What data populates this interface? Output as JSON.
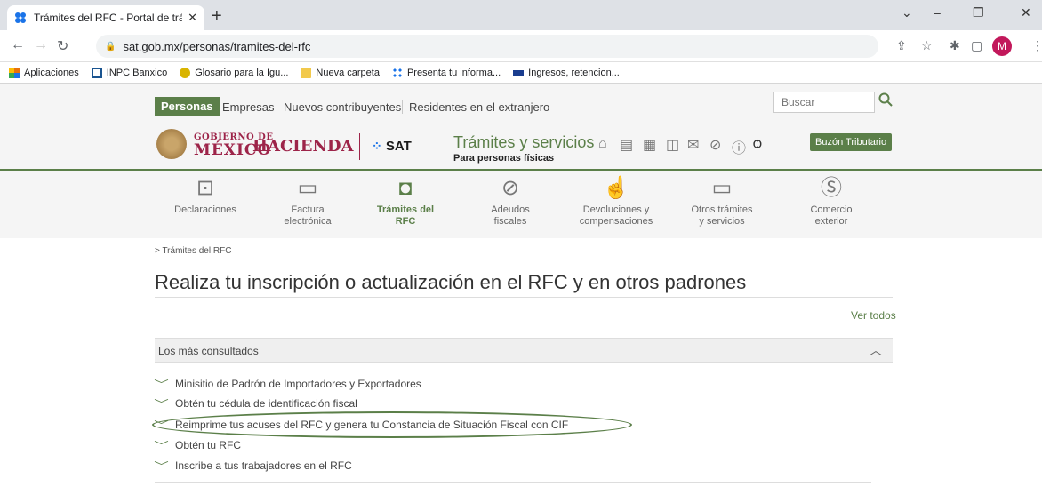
{
  "browser": {
    "tab_title": "Trámites del RFC - Portal de trám",
    "new_tab": "+",
    "window_buttons": [
      "⌄",
      "–",
      "❐",
      "✕"
    ],
    "url": "sat.gob.mx/personas/tramites-del-rfc",
    "profile_initial": "M",
    "bookmarks": [
      {
        "label": "Aplicaciones",
        "icon": "apps-grid-icon",
        "color": "#e8710a"
      },
      {
        "label": "INPC Banxico",
        "icon": "bank-icon",
        "color": "#1a5490"
      },
      {
        "label": "Glosario para la Igu...",
        "icon": "sun-icon",
        "color": "#d9b400"
      },
      {
        "label": "Nueva carpeta",
        "icon": "folder-icon",
        "color": "#f2c94c"
      },
      {
        "label": "Presenta tu informa...",
        "icon": "sat-icon",
        "color": "#5b7f49"
      },
      {
        "label": "Ingresos, retencion...",
        "icon": "fira-icon",
        "color": "#1a3d8f"
      }
    ]
  },
  "topnav": {
    "active": "Personas",
    "items": [
      "Empresas",
      "Nuevos contribuyentes",
      "Residentes en el extranjero"
    ],
    "search_placeholder": "Buscar"
  },
  "brand": {
    "gob_line1": "GOBIERNO DE",
    "gob_line2": "MÉXICO",
    "hacienda": "HACIENDA",
    "sat": "SAT",
    "section_title": "Trámites y servicios",
    "section_sub": "Para personas físicas",
    "buzon": "Buzón Tributario",
    "accent": "#5b7f49",
    "gob_color": "#9d2449"
  },
  "secnav": [
    {
      "line1": "Declaraciones",
      "line2": "",
      "icon": "declaraciones-icon"
    },
    {
      "line1": "Factura",
      "line2": "electrónica",
      "icon": "factura-icon"
    },
    {
      "line1": "Trámites del",
      "line2": "RFC",
      "icon": "tramites-icon",
      "active": true
    },
    {
      "line1": "Adeudos",
      "line2": "fiscales",
      "icon": "adeudos-icon"
    },
    {
      "line1": "Devoluciones y",
      "line2": "compensaciones",
      "icon": "devoluciones-icon"
    },
    {
      "line1": "Otros trámites",
      "line2": "y servicios",
      "icon": "otros-icon"
    },
    {
      "line1": "Comercio",
      "line2": "exterior",
      "icon": "comercio-icon"
    }
  ],
  "content": {
    "breadcrumb": "> Trámites del RFC",
    "title": "Realiza tu inscripción o actualización en el RFC y en otros padrones",
    "ver_todos": "Ver todos",
    "accordion_title": "Los más consultados",
    "items": [
      "Minisitio de Padrón de Importadores y Exportadores",
      "Obtén tu cédula de identificación fiscal",
      "Reimprime tus acuses del RFC y genera tu Constancia de Situación Fiscal con CIF",
      "Obtén tu RFC",
      "Inscribe a tus trabajadores en el RFC"
    ]
  }
}
